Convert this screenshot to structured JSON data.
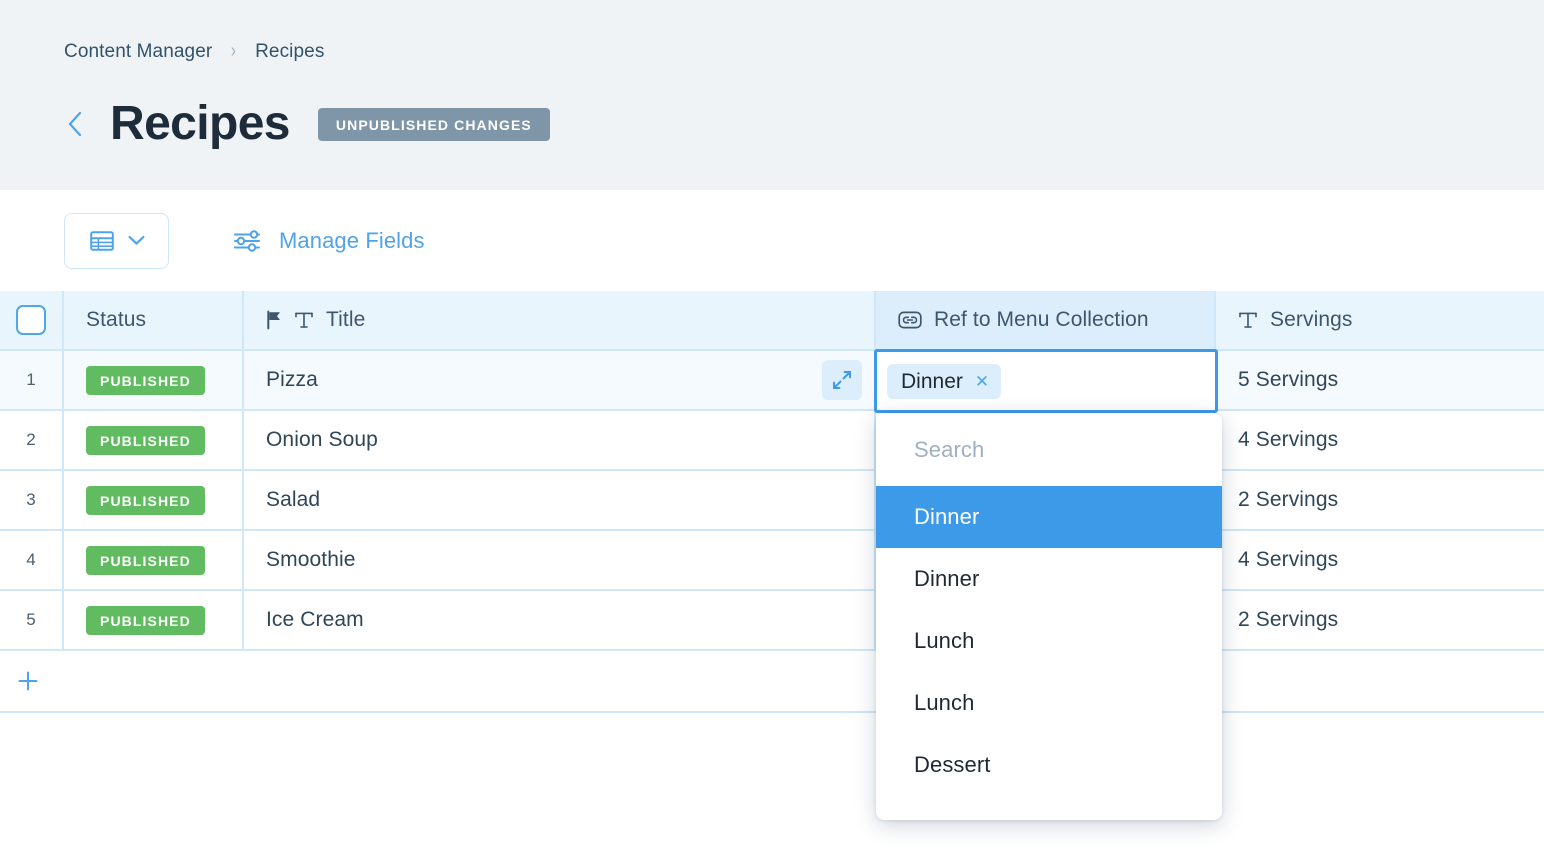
{
  "breadcrumb": {
    "items": [
      "Content Manager",
      "Recipes"
    ],
    "separator": "›"
  },
  "header": {
    "title": "Recipes",
    "status_badge": "UNPUBLISHED CHANGES",
    "back_icon": "chevron-left-icon"
  },
  "toolbar": {
    "view_icon": "table-view-icon",
    "view_chevron_icon": "chevron-down-icon",
    "manage_fields_icon": "sliders-icon",
    "manage_fields_label": "Manage Fields"
  },
  "table": {
    "columns": [
      {
        "key": "check",
        "label": "",
        "icon": "checkbox-icon"
      },
      {
        "key": "status",
        "label": "Status",
        "icon": null
      },
      {
        "key": "title",
        "label": "Title",
        "icon": "text-type-icon",
        "flag_icon": "flag-icon"
      },
      {
        "key": "ref",
        "label": "Ref to Menu Collection",
        "icon": "reference-link-icon"
      },
      {
        "key": "servings",
        "label": "Servings",
        "icon": "text-type-icon"
      }
    ],
    "rows": [
      {
        "num": "1",
        "status": "PUBLISHED",
        "title": "Pizza",
        "ref": "Dinner",
        "servings": "5 Servings"
      },
      {
        "num": "2",
        "status": "PUBLISHED",
        "title": "Onion Soup",
        "ref": "",
        "servings": "4 Servings"
      },
      {
        "num": "3",
        "status": "PUBLISHED",
        "title": "Salad",
        "ref": "",
        "servings": "2 Servings"
      },
      {
        "num": "4",
        "status": "PUBLISHED",
        "title": "Smoothie",
        "ref": "",
        "servings": "4 Servings"
      },
      {
        "num": "5",
        "status": "PUBLISHED",
        "title": "Ice Cream",
        "ref": "",
        "servings": "2 Servings"
      }
    ],
    "add_row_icon": "plus-icon",
    "expand_icon": "expand-diagonal-icon"
  },
  "ref_editor": {
    "tag_label": "Dinner",
    "tag_remove_icon": "close-x-icon"
  },
  "dropdown": {
    "search_placeholder": "Search",
    "options": [
      {
        "label": "Dinner",
        "highlighted": true
      },
      {
        "label": "Dinner",
        "highlighted": false
      },
      {
        "label": "Lunch",
        "highlighted": false
      },
      {
        "label": "Lunch",
        "highlighted": false
      },
      {
        "label": "Dessert",
        "highlighted": false
      }
    ]
  },
  "colors": {
    "accent_blue": "#3D9AE8",
    "link_blue": "#4FA3E8",
    "published_green": "#61BC61",
    "badge_grey": "#7F96A8",
    "header_bg": "#EFF3F6",
    "table_header_bg": "#E9F5FD",
    "grid_line": "#CFE7F8",
    "title_text": "#1D2B3A"
  }
}
